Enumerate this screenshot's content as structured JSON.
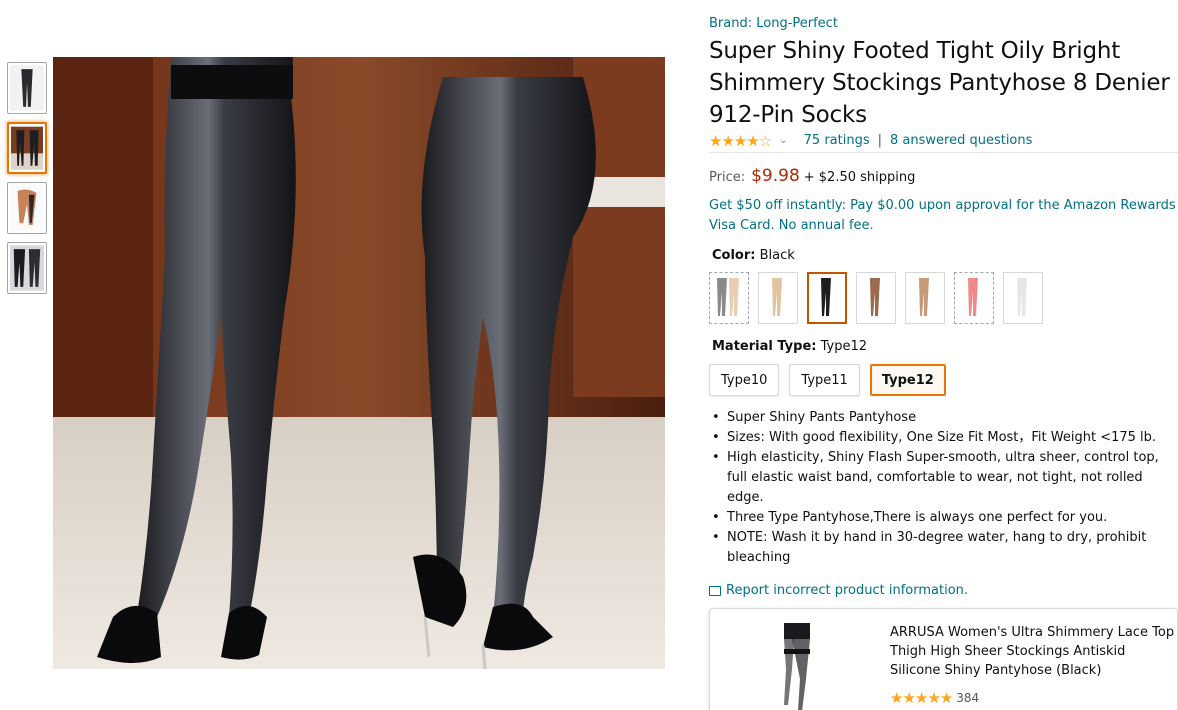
{
  "brand": "Brand: Long-Perfect",
  "title": "Super Shiny Footed Tight Oily Bright Shimmery Stockings Pantyhose 8 Denier 912-Pin Socks",
  "rating": {
    "stars_display": "★★★★☆",
    "value": 4.5,
    "ratings_text": "75 ratings",
    "questions_text": "8 answered questions",
    "separator": "|"
  },
  "price": {
    "label": "Price:",
    "amount": "$9.98",
    "shipping": "+ $2.50 shipping"
  },
  "promo": "Get $50 off instantly: Pay $0.00 upon approval for the Amazon Rewards Visa Card. No annual fee.",
  "color": {
    "label": "Color:",
    "selected": "Black",
    "swatches": [
      {
        "name": "multi",
        "legs": [
          "#8a8a8a",
          "#e8cfb3"
        ],
        "dashed": true
      },
      {
        "name": "nude",
        "legs": [
          "#e2c3a0"
        ],
        "dashed": false
      },
      {
        "name": "black",
        "legs": [
          "#1e1e22"
        ],
        "dashed": false,
        "selected": true
      },
      {
        "name": "brown",
        "legs": [
          "#9a6a4c"
        ],
        "dashed": false
      },
      {
        "name": "tan",
        "legs": [
          "#c89b78"
        ],
        "dashed": false
      },
      {
        "name": "pink",
        "legs": [
          "#f08a8a"
        ],
        "dashed": true
      },
      {
        "name": "white",
        "legs": [
          "#e6e6ea"
        ],
        "dashed": false
      }
    ]
  },
  "material": {
    "label": "Material Type:",
    "selected": "Type12",
    "options": [
      "Type10",
      "Type11",
      "Type12"
    ]
  },
  "bullets": [
    "Super Shiny Pants Pantyhose",
    "Sizes: With good flexibility, One Size Fit Most，Fit Weight <175 lb.",
    "High elasticity, Shiny Flash Super-smooth, ultra sheer, control top, full elastic waist band, comfortable to wear, not tight, not rolled edge.",
    "Three Type Pantyhose,There is always one perfect for you.",
    "NOTE: Wash it by hand in 30-degree water, hang to dry, prohibit bleaching"
  ],
  "report_link": "Report incorrect product information.",
  "sponsored": {
    "title": "ARRUSA Women's Ultra Shimmery Lace Top Thigh High Sheer Stockings Antiskid Silicone Shiny Pantyhose (Black)",
    "stars_display": "★★★★★",
    "count": "384"
  },
  "colors": {
    "link": "#007185",
    "price": "#b12704",
    "star": "#ffa41c",
    "selected_border": "#e77600"
  }
}
